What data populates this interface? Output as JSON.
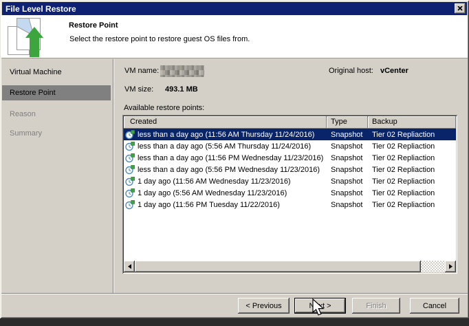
{
  "window": {
    "title": "File Level Restore"
  },
  "banner": {
    "title": "Restore Point",
    "subtitle": "Select the restore point to restore guest OS files from."
  },
  "sidebar": {
    "items": [
      {
        "label": "Virtual Machine",
        "state": "enabled"
      },
      {
        "label": "Restore Point",
        "state": "selected"
      },
      {
        "label": "Reason",
        "state": "disabled"
      },
      {
        "label": "Summary",
        "state": "disabled"
      }
    ]
  },
  "details": {
    "vm_name_label": "VM name:",
    "vm_name_value_redacted": true,
    "vm_size_label": "VM size:",
    "vm_size_value": "493.1 MB",
    "original_host_label": "Original host:",
    "original_host_value": "vCenter",
    "list_label": "Available restore points:"
  },
  "restore_points": {
    "columns": [
      "Created",
      "Type",
      "Backup"
    ],
    "selected_index": 0,
    "rows": [
      {
        "created": "less than a day ago (11:56 AM Thursday 11/24/2016)",
        "type": "Snapshot",
        "backup": "Tier 02 Repliaction"
      },
      {
        "created": "less than a day ago (5:56 AM Thursday 11/24/2016)",
        "type": "Snapshot",
        "backup": "Tier 02 Repliaction"
      },
      {
        "created": "less than a day ago (11:56 PM Wednesday 11/23/2016)",
        "type": "Snapshot",
        "backup": "Tier 02 Repliaction"
      },
      {
        "created": "less than a day ago (5:56 PM Wednesday 11/23/2016)",
        "type": "Snapshot",
        "backup": "Tier 02 Repliaction"
      },
      {
        "created": "1 day ago (11:56 AM Wednesday 11/23/2016)",
        "type": "Snapshot",
        "backup": "Tier 02 Repliaction"
      },
      {
        "created": "1 day ago (5:56 AM Wednesday 11/23/2016)",
        "type": "Snapshot",
        "backup": "Tier 02 Repliaction"
      },
      {
        "created": "1 day ago (11:56 PM Tuesday 11/22/2016)",
        "type": "Snapshot",
        "backup": "Tier 02 Repliaction"
      }
    ]
  },
  "buttons": {
    "previous": "< Previous",
    "next": "Next >",
    "finish": "Finish",
    "cancel": "Cancel"
  },
  "colors": {
    "titlebar": "#0e2173",
    "selection": "#0a246a",
    "dialog_gray": "#d4d0c8",
    "sidebar_selected": "#808080",
    "accent_green": "#3da53d",
    "clock_blue": "#4f8fc0"
  }
}
